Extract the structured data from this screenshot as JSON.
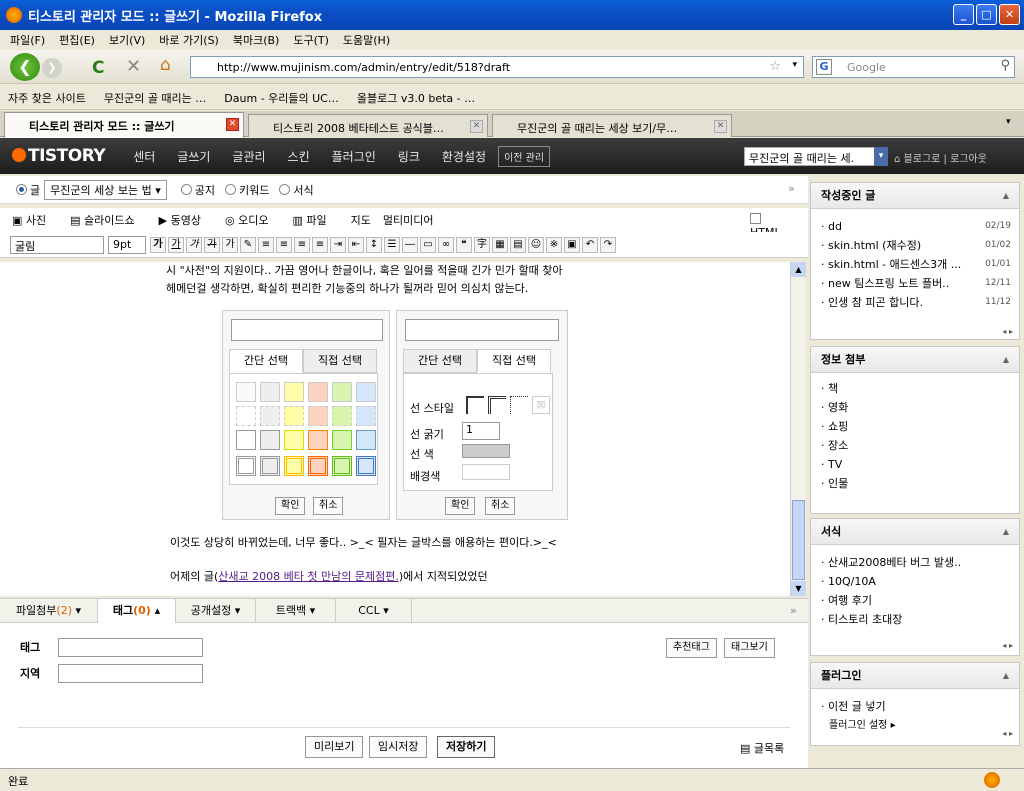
{
  "window": {
    "title": "티스토리 관리자 모드 :: 글쓰기 - Mozilla Firefox"
  },
  "menu": [
    "파일(F)",
    "편집(E)",
    "보기(V)",
    "바로 가기(S)",
    "북마크(B)",
    "도구(T)",
    "도움말(H)"
  ],
  "nav": {
    "url": "http://www.mujinism.com/admin/entry/edit/518?draft",
    "search_placeholder": "Google"
  },
  "bookmarks": [
    "자주 찾은 사이트",
    "무진군의 골 때리는 …",
    "Daum - 우리들의 UC…",
    "올블로그 v3.0 beta - …"
  ],
  "tabs": [
    "티스토리 관리자 모드 :: 글쓰기",
    "티스토리 2008 베타테스트 공식블…",
    "무진군의 골 때리는 세상 보기/무…"
  ],
  "tistory": {
    "logo": "TISTORY",
    "menus": [
      "센터",
      "글쓰기",
      "글관리",
      "스킨",
      "플러그인",
      "링크",
      "환경설정"
    ],
    "old_admin": "이전 관리",
    "blog_select": "무진군의 골 때리는 세.",
    "blog_link": "블로그로",
    "logout": "로그아웃"
  },
  "editor": {
    "type_options": [
      "글",
      "공지",
      "키워드",
      "서식"
    ],
    "category": "무진군의 세상 보는 법",
    "attach": [
      "사진",
      "슬라이드쇼",
      "동영상",
      "오디오",
      "파일",
      "지도",
      "멀티미디어"
    ],
    "html_label": "HTML",
    "font": "굴림",
    "size": "9pt",
    "line1": "시 \"사전\"의 지원이다.. 가끔 영어나 한글이나, 혹은 일어를 적을때 긴가 민가 할때 찾아",
    "line2": "헤메던걸 생각하면, 확실히 편리한 기능중의 하나가 될꺼라 믿어 의심치 않는다.",
    "line3": "이것도 상당히 바뀌었는데, 너무 좋다.. >_< 필자는 글박스를 애용하는 편이다.>_<",
    "line4_pre": "어제의 글(",
    "line4_link": "산새교 2008 베타 첫 만남의 문제점편.",
    "line4_post": ")에서 지적되었었던",
    "picker": {
      "tab_simple": "간단 선택",
      "tab_direct": "직접 선택",
      "ok": "확인",
      "cancel": "취소",
      "line_style": "선 스타일",
      "line_width": "선 굵기",
      "line_width_value": "1",
      "line_color": "선 색",
      "bg_color": "배경색"
    }
  },
  "tagtabs": {
    "attach": "파일첨부",
    "attach_count": "(2)",
    "tag": "태그",
    "tag_count": "(0)",
    "public": "공개설정",
    "trackback": "트랙백",
    "ccl": "CCL"
  },
  "tagpanel": {
    "tag_label": "태그",
    "region_label": "지역",
    "recommend": "추천태그",
    "show_tags": "태그보기",
    "preview": "미리보기",
    "temp_save": "임시저장",
    "save": "저장하기",
    "list": "글목록"
  },
  "sidebar": {
    "drafts": {
      "title": "작성중인 글",
      "items": [
        {
          "t": "dd",
          "d": "02/19"
        },
        {
          "t": "skin.html (재수정)",
          "d": "01/02"
        },
        {
          "t": "skin.html - 애드센스3개 ...",
          "d": "01/01"
        },
        {
          "t": "new 팀스프링 노트 플버..",
          "d": "12/11"
        },
        {
          "t": "인생 참 피곤 합니다.",
          "d": "11/12"
        }
      ]
    },
    "info": {
      "title": "정보 첨부",
      "items": [
        "책",
        "영화",
        "쇼핑",
        "장소",
        "TV",
        "인물"
      ]
    },
    "forms": {
      "title": "서식",
      "items": [
        "산새교2008베타 버그 발생..",
        "10Q/10A",
        "여행 후기",
        "티스토리 초대장"
      ]
    },
    "plugins": {
      "title": "플러그인",
      "items": [
        "이전 글 넣기"
      ],
      "setting": "플러그인 설정"
    }
  },
  "status": "완료",
  "colors": {
    "accent": "#0a5fd8",
    "tistory_orange": "#ff6a00"
  }
}
